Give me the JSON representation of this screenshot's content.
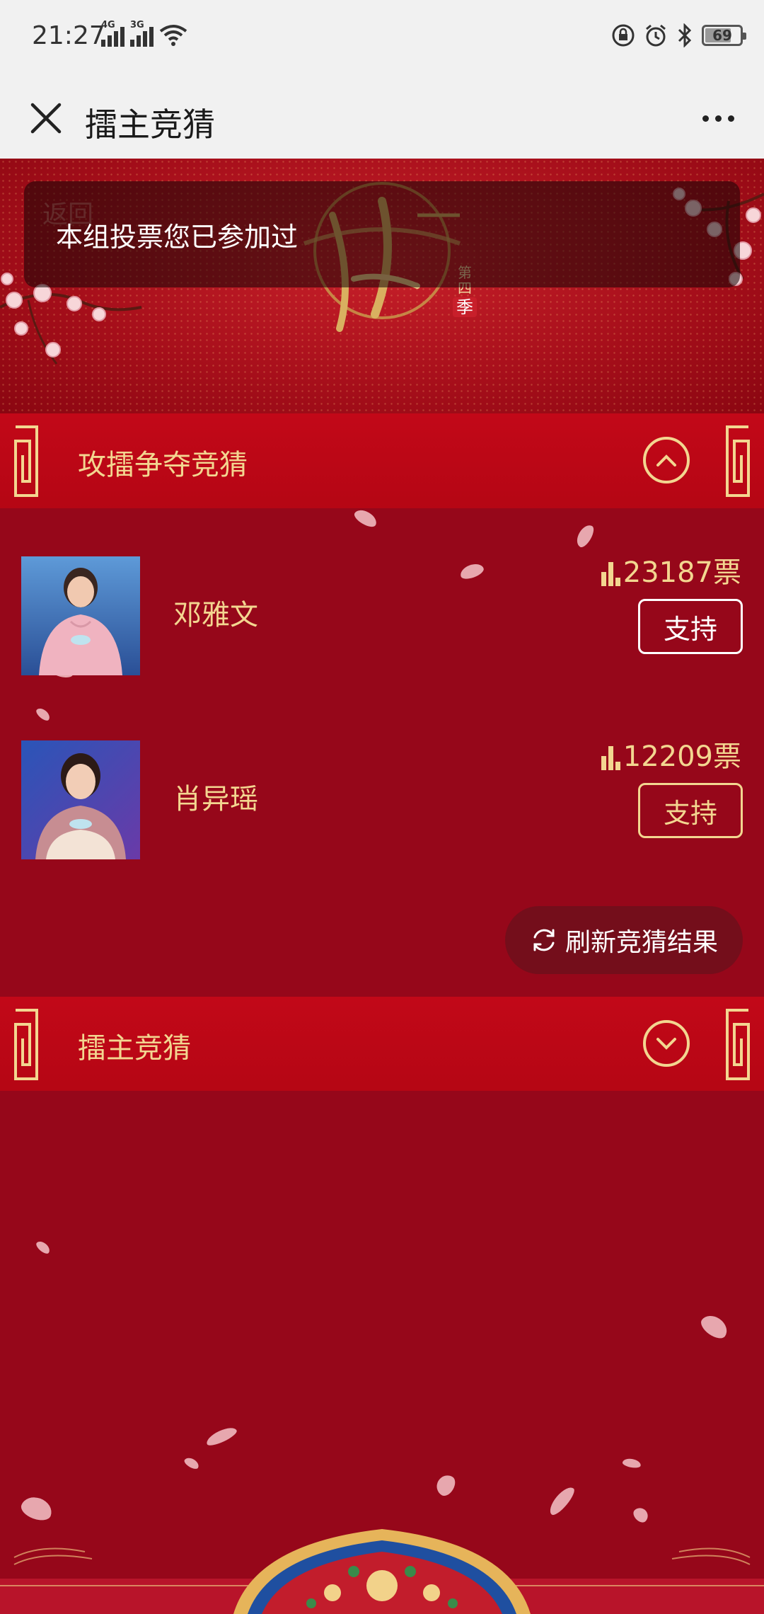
{
  "status_bar": {
    "time": "21:27",
    "network_1": "4G",
    "network_2": "3G",
    "battery": "69",
    "battery_level": 0.69
  },
  "app_bar": {
    "title": "擂主竞猜"
  },
  "hero": {
    "back_label": "返回",
    "season_label": "第四",
    "season_seal": "季"
  },
  "toast": {
    "message": "本组投票您已参加过"
  },
  "section1": {
    "title": "攻擂争夺竞猜",
    "candidates": [
      {
        "name": "邓雅文",
        "votes": "23187票",
        "support_label": "支持"
      },
      {
        "name": "肖异瑶",
        "votes": "12209票",
        "support_label": "支持"
      }
    ],
    "refresh_label": "刷新竞猜结果"
  },
  "section2": {
    "title": "擂主竞猜"
  },
  "colors": {
    "gold": "#f3d690",
    "header_red": "#c20818",
    "body_red": "#96071a"
  }
}
